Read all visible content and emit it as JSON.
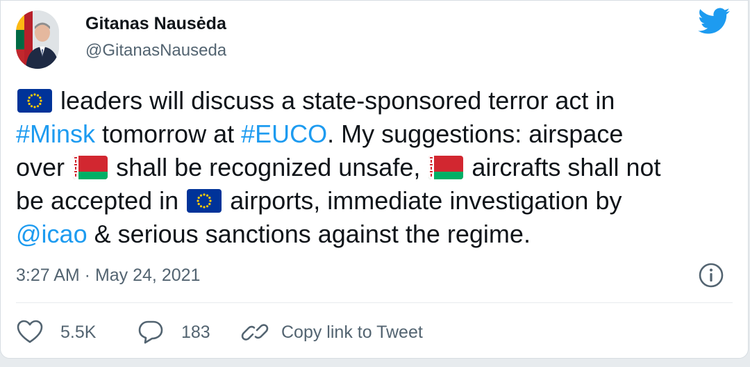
{
  "account": {
    "name": "Gitanas Nausėda",
    "handle": "@GitanasNauseda"
  },
  "tweet": {
    "lines": {
      "l1": {
        "text": "leaders will discuss a state-sponsored terror act in"
      },
      "l2": {
        "hashtag1": "#Minsk",
        "text1": "tomorrow at",
        "hashtag2": "#EUCO",
        "text2": ". My suggestions: airspace"
      },
      "l3": {
        "text1": "over",
        "text2": "shall be recognized unsafe,",
        "text3": "aircrafts shall not"
      },
      "l4": {
        "text1": "be accepted in",
        "text2": "airports, immediate investigation by"
      },
      "l5": {
        "mention": "@icao",
        "text": "& serious sanctions against the regime."
      }
    },
    "flags": {
      "eu": "flag-eu-icon",
      "belarus": "flag-belarus-icon"
    },
    "timestamp": "3:27 AM · May 24, 2021"
  },
  "actions": {
    "likes": "5.5K",
    "replies": "183",
    "copy_link": "Copy link to Tweet"
  },
  "colors": {
    "link": "#1d9bf0",
    "secondary_text": "#536471",
    "primary_text": "#0f1419",
    "twitter_blue": "#1d9bf0",
    "eu_blue": "#003399",
    "eu_star": "#ffcc00",
    "belarus_red": "#d22730",
    "belarus_green": "#00af66"
  },
  "icons": {
    "twitter": "twitter-bird-icon",
    "info": "info-icon",
    "like": "heart-icon",
    "reply": "speech-bubble-icon",
    "copy": "link-icon"
  }
}
